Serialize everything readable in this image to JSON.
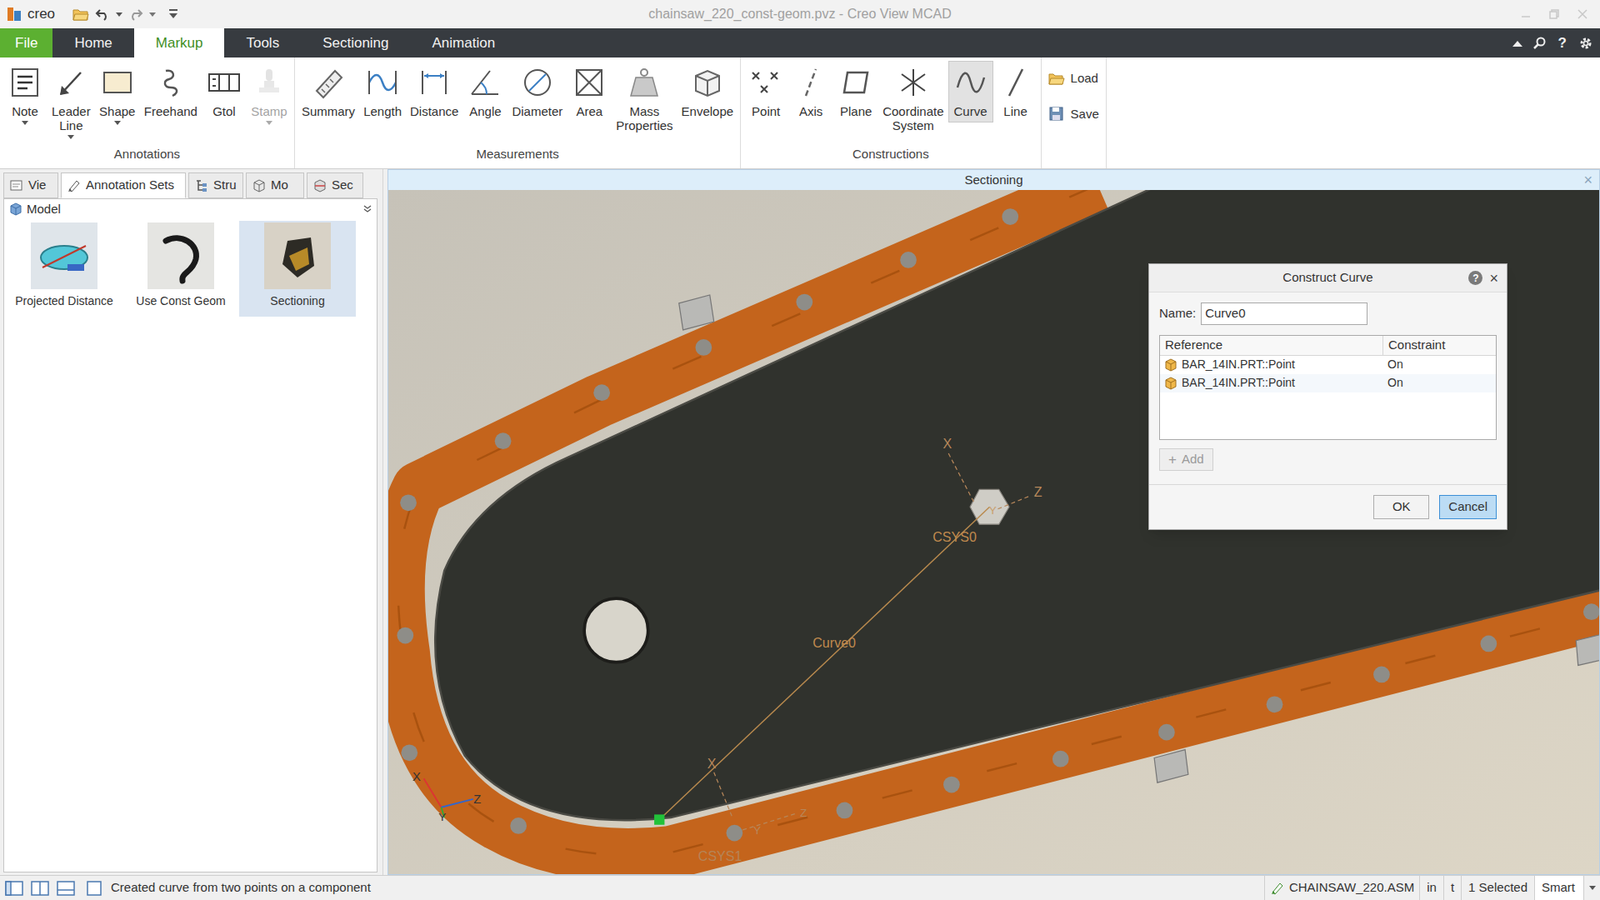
{
  "window": {
    "title": "chainsaw_220_const-geom.pvz - Creo View MCAD",
    "logo": "creo"
  },
  "ribbon_tabs": [
    {
      "label": "File",
      "kind": "menu",
      "selected": false
    },
    {
      "label": "Home",
      "kind": "tab",
      "selected": false
    },
    {
      "label": "Markup",
      "kind": "tab",
      "selected": true
    },
    {
      "label": "Tools",
      "kind": "tab",
      "selected": false
    },
    {
      "label": "Sectioning",
      "kind": "tab",
      "selected": false
    },
    {
      "label": "Animation",
      "kind": "tab",
      "selected": false
    }
  ],
  "ribbon_tools": {
    "help": "?"
  },
  "ribbon_groups": [
    {
      "label": "Annotations",
      "buttons": [
        {
          "label": "Note",
          "dropdown": true,
          "disabled": false,
          "selected": false
        },
        {
          "label": "Leader Line",
          "dropdown": true,
          "disabled": false,
          "selected": false
        },
        {
          "label": "Shape",
          "dropdown": true,
          "disabled": false,
          "selected": false
        },
        {
          "label": "Freehand",
          "dropdown": false,
          "disabled": false,
          "selected": false
        },
        {
          "label": "Gtol",
          "dropdown": false,
          "disabled": false,
          "selected": false
        },
        {
          "label": "Stamp",
          "dropdown": true,
          "disabled": true,
          "selected": false
        }
      ]
    },
    {
      "label": "Measurements",
      "buttons": [
        {
          "label": "Summary",
          "dropdown": false,
          "disabled": false,
          "selected": false
        },
        {
          "label": "Length",
          "dropdown": false,
          "disabled": false,
          "selected": false
        },
        {
          "label": "Distance",
          "dropdown": false,
          "disabled": false,
          "selected": false
        },
        {
          "label": "Angle",
          "dropdown": false,
          "disabled": false,
          "selected": false
        },
        {
          "label": "Diameter",
          "dropdown": false,
          "disabled": false,
          "selected": false
        },
        {
          "label": "Area",
          "dropdown": false,
          "disabled": false,
          "selected": false
        },
        {
          "label": "Mass Properties",
          "dropdown": false,
          "disabled": false,
          "selected": false
        },
        {
          "label": "Envelope",
          "dropdown": false,
          "disabled": false,
          "selected": false
        }
      ]
    },
    {
      "label": "Constructions",
      "buttons": [
        {
          "label": "Point",
          "dropdown": false,
          "disabled": false,
          "selected": false
        },
        {
          "label": "Axis",
          "dropdown": false,
          "disabled": false,
          "selected": false
        },
        {
          "label": "Plane",
          "dropdown": false,
          "disabled": false,
          "selected": false
        },
        {
          "label": "Coordinate System",
          "dropdown": false,
          "disabled": false,
          "selected": false
        },
        {
          "label": "Curve",
          "dropdown": false,
          "disabled": false,
          "selected": true
        },
        {
          "label": "Line",
          "dropdown": false,
          "disabled": false,
          "selected": false
        }
      ]
    }
  ],
  "file_buttons": [
    {
      "label": "Load"
    },
    {
      "label": "Save"
    }
  ],
  "panel_tabs": [
    {
      "label": "Vie",
      "selected": false
    },
    {
      "label": "Annotation Sets",
      "selected": true
    },
    {
      "label": "Stru",
      "selected": false
    },
    {
      "label": "Mo",
      "selected": false
    },
    {
      "label": "Sec",
      "selected": false
    }
  ],
  "model_selector": {
    "label": "Model"
  },
  "annotation_sets": [
    {
      "label": "Projected Distance",
      "selected": false
    },
    {
      "label": "Use Const Geom",
      "selected": false
    },
    {
      "label": "Sectioning",
      "selected": true
    }
  ],
  "viewport": {
    "title": "Sectioning",
    "close": "×",
    "labels": [
      "X",
      "Z",
      "Y",
      "CSYS0",
      "Curve0",
      "X",
      "Y",
      "Z",
      "CSYS1",
      "X",
      "Y",
      "Z"
    ]
  },
  "dialog": {
    "title": "Construct Curve",
    "help": "?",
    "close": "×",
    "name_label": "Name:",
    "name_value": "Curve0",
    "columns": [
      "Reference",
      "Constraint"
    ],
    "rows": [
      [
        "BAR_14IN.PRT::Point",
        "On"
      ],
      [
        "BAR_14IN.PRT::Point",
        "On"
      ]
    ],
    "add_button": {
      "icon": "+",
      "label": "Add",
      "disabled": true
    },
    "buttons": [
      {
        "label": "OK",
        "selected": false
      },
      {
        "label": "Cancel",
        "selected": true
      }
    ]
  },
  "status_bar": {
    "message": "Created curve from two points on a component",
    "model": "CHAINSAW_220.ASM",
    "units": "in",
    "t": "t",
    "selection": "1 Selected",
    "filter": "Smart"
  }
}
